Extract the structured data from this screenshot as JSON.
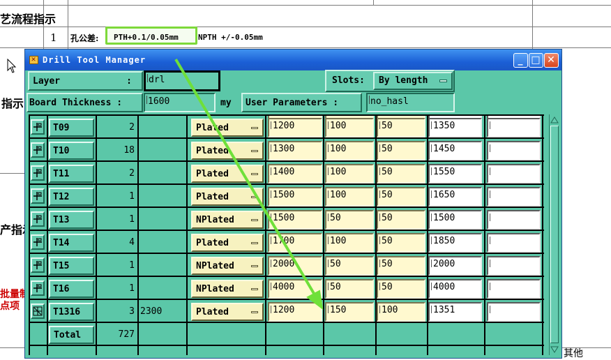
{
  "document": {
    "row1_title": "艺流程指示",
    "row2_index": "1",
    "row2_label": "孔公差:",
    "row2_value_pth": "PTH+0.1/0.05mm",
    "row2_value_npth": "NPTH +/-0.05mm",
    "left_label_a": "指示",
    "left_label_b": "产指示",
    "left_red_a": "批量制",
    "left_red_b": "点项",
    "bottom_right": "其他"
  },
  "window": {
    "title": "Drill Tool Manager",
    "controls": {
      "minimize": "_",
      "maximize": "□",
      "close": "✕"
    }
  },
  "form": {
    "layer_label": "Layer",
    "layer_colon": ":",
    "layer_value": "drl",
    "slots_label": "Slots:",
    "slots_value": "By length",
    "board_thickness_label": "Board Thickness :",
    "board_thickness_value": "1600",
    "board_thickness_unit": "my",
    "user_params_label": "User Parameters :",
    "user_params_value": "no_hasl"
  },
  "rows": [
    {
      "tool": "T09",
      "count": "2",
      "extra": "",
      "type": "Plated",
      "v1": "1200",
      "v2": "100",
      "v3": "50",
      "v4": "1350",
      "v5": ""
    },
    {
      "tool": "T10",
      "count": "18",
      "extra": "",
      "type": "Plated",
      "v1": "1300",
      "v2": "100",
      "v3": "50",
      "v4": "1450",
      "v5": ""
    },
    {
      "tool": "T11",
      "count": "2",
      "extra": "",
      "type": "Plated",
      "v1": "1400",
      "v2": "100",
      "v3": "50",
      "v4": "1550",
      "v5": ""
    },
    {
      "tool": "T12",
      "count": "1",
      "extra": "",
      "type": "Plated",
      "v1": "1500",
      "v2": "100",
      "v3": "50",
      "v4": "1650",
      "v5": ""
    },
    {
      "tool": "T13",
      "count": "1",
      "extra": "",
      "type": "NPlated",
      "v1": "1500",
      "v2": "50",
      "v3": "50",
      "v4": "1500",
      "v5": ""
    },
    {
      "tool": "T14",
      "count": "4",
      "extra": "",
      "type": "Plated",
      "v1": "1700",
      "v2": "100",
      "v3": "50",
      "v4": "1850",
      "v5": ""
    },
    {
      "tool": "T15",
      "count": "1",
      "extra": "",
      "type": "NPlated",
      "v1": "2000",
      "v2": "50",
      "v3": "50",
      "v4": "2000",
      "v5": ""
    },
    {
      "tool": "T16",
      "count": "1",
      "extra": "",
      "type": "NPlated",
      "v1": "4000",
      "v2": "50",
      "v3": "50",
      "v4": "4000",
      "v5": ""
    },
    {
      "tool": "T1316",
      "count": "3",
      "extra": "2300",
      "type": "Plated",
      "v1": "1200",
      "v2": "150",
      "v3": "100",
      "v4": "1351",
      "v5": ""
    }
  ],
  "total": {
    "label": "Total",
    "count": "727"
  },
  "colors": {
    "dialog_bg": "#5bc7a8",
    "input_yellow": "#fff9cf",
    "titlebar_blue": "#1b5fd6",
    "annotation_green": "#6fe03a"
  }
}
